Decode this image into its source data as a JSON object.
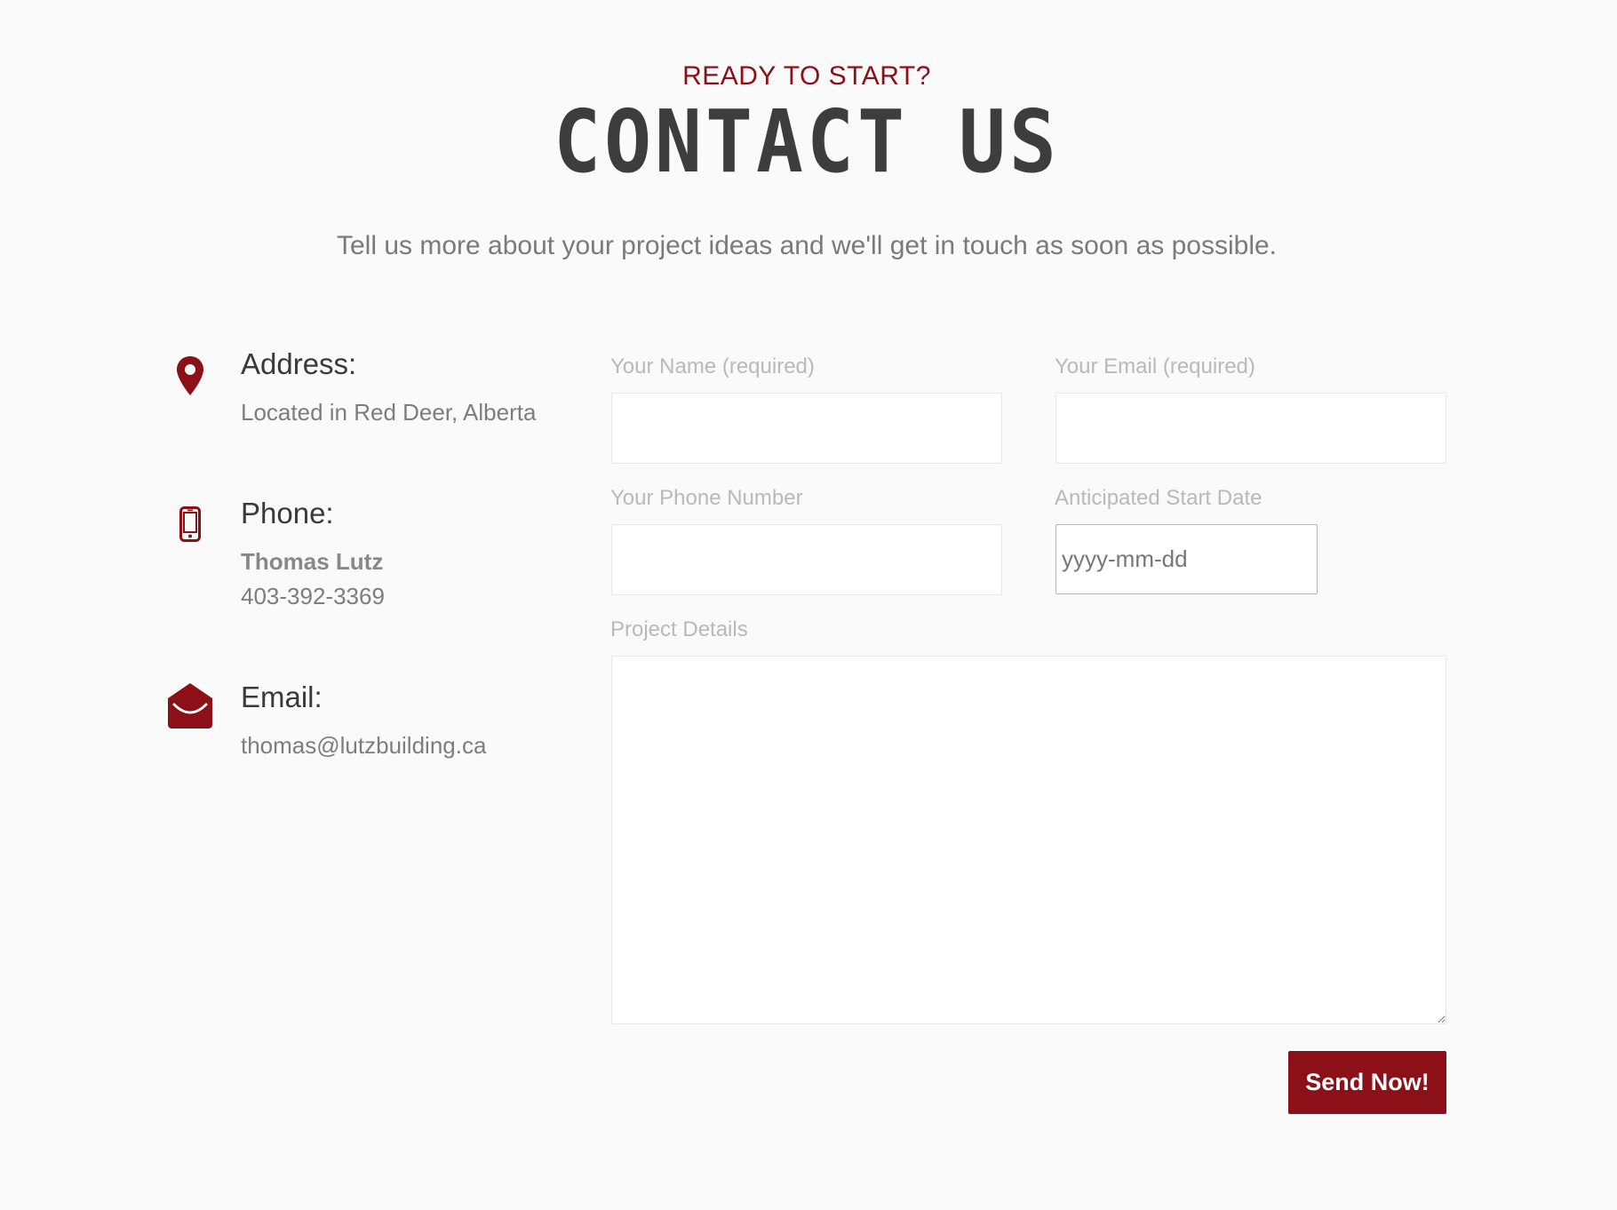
{
  "header": {
    "eyebrow": "READY TO START?",
    "title": "CONTACT US",
    "lead": "Tell us more about your project ideas and we'll get in touch as soon as possible."
  },
  "contact_info": {
    "accent_color": "#8b1017",
    "address": {
      "icon": "map-pin-icon",
      "title": "Address:",
      "text": "Located in Red Deer, Alberta"
    },
    "phone": {
      "icon": "mobile-phone-icon",
      "title": "Phone:",
      "name": "Thomas Lutz",
      "number": "403-392-3369"
    },
    "email": {
      "icon": "open-envelope-icon",
      "title": "Email:",
      "address": "thomas@lutzbuilding.ca"
    }
  },
  "form": {
    "name_label": "Your Name (required)",
    "email_label": "Your Email (required)",
    "phone_label": "Your Phone Number",
    "date_label": "Anticipated Start Date",
    "date_placeholder": "yyyy-mm-dd",
    "details_label": "Project Details",
    "submit_label": "Send Now!"
  }
}
